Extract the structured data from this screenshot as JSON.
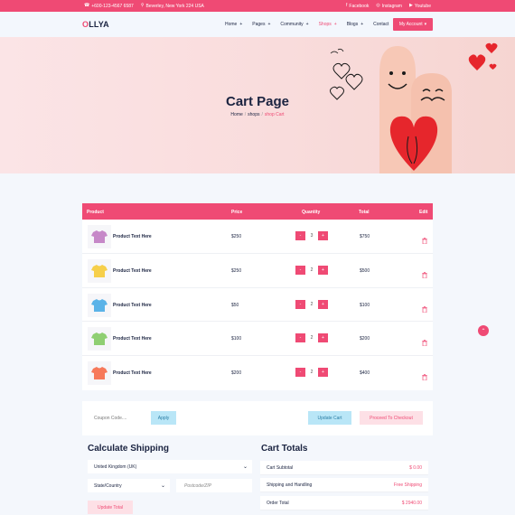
{
  "topbar": {
    "phone": "+600-123-4567 6587",
    "address": "Beverley, New York 224 USA",
    "facebook": "Facebook",
    "instagram": "Instagram",
    "youtube": "Youtube"
  },
  "header": {
    "logo_accent": "O",
    "logo_rest": "LLYA",
    "nav": [
      "Home",
      "Pages",
      "Community",
      "Shops",
      "Blogs",
      "Contact"
    ],
    "account_label": "My Account"
  },
  "hero": {
    "title": "Cart Page",
    "breadcrumb": [
      "Home",
      "shops",
      "shop Cart"
    ]
  },
  "cart": {
    "columns": [
      "Product",
      "Price",
      "Quantity",
      "Total",
      "Edit"
    ],
    "rows": [
      {
        "name": "Product Text Here",
        "price": "$250",
        "qty": "3",
        "total": "$750",
        "color": "#c688c8"
      },
      {
        "name": "Product Text Here",
        "price": "$250",
        "qty": "2",
        "total": "$500",
        "color": "#f6cf4a"
      },
      {
        "name": "Product Text Here",
        "price": "$50",
        "qty": "2",
        "total": "$100",
        "color": "#5bb3e8"
      },
      {
        "name": "Product Text Here",
        "price": "$100",
        "qty": "2",
        "total": "$200",
        "color": "#8fcf72"
      },
      {
        "name": "Product Text Here",
        "price": "$200",
        "qty": "2",
        "total": "$400",
        "color": "#f7795a"
      }
    ]
  },
  "coupon": {
    "placeholder": "Coupon Code....",
    "apply": "Apply",
    "update_cart": "Update Cart",
    "checkout": "Proceed To Checkout"
  },
  "shipping": {
    "title": "Calculate Shipping",
    "country": "United Kingdom (UK)",
    "state": "State/Country",
    "postcode": "Postcode/ZIP",
    "update_total": "Update Total"
  },
  "totals": {
    "title": "Cart Totals",
    "rows": [
      {
        "label": "Cart Subtotal",
        "value": "$ 0.00"
      },
      {
        "label": "Shipping and Handling",
        "value": "Free Shipping"
      },
      {
        "label": "Order Total",
        "value": "$ 2940.00"
      }
    ]
  },
  "colors": {
    "accent": "#ef4a74",
    "dark": "#1a2340",
    "light_blue": "#b9e6f7"
  }
}
